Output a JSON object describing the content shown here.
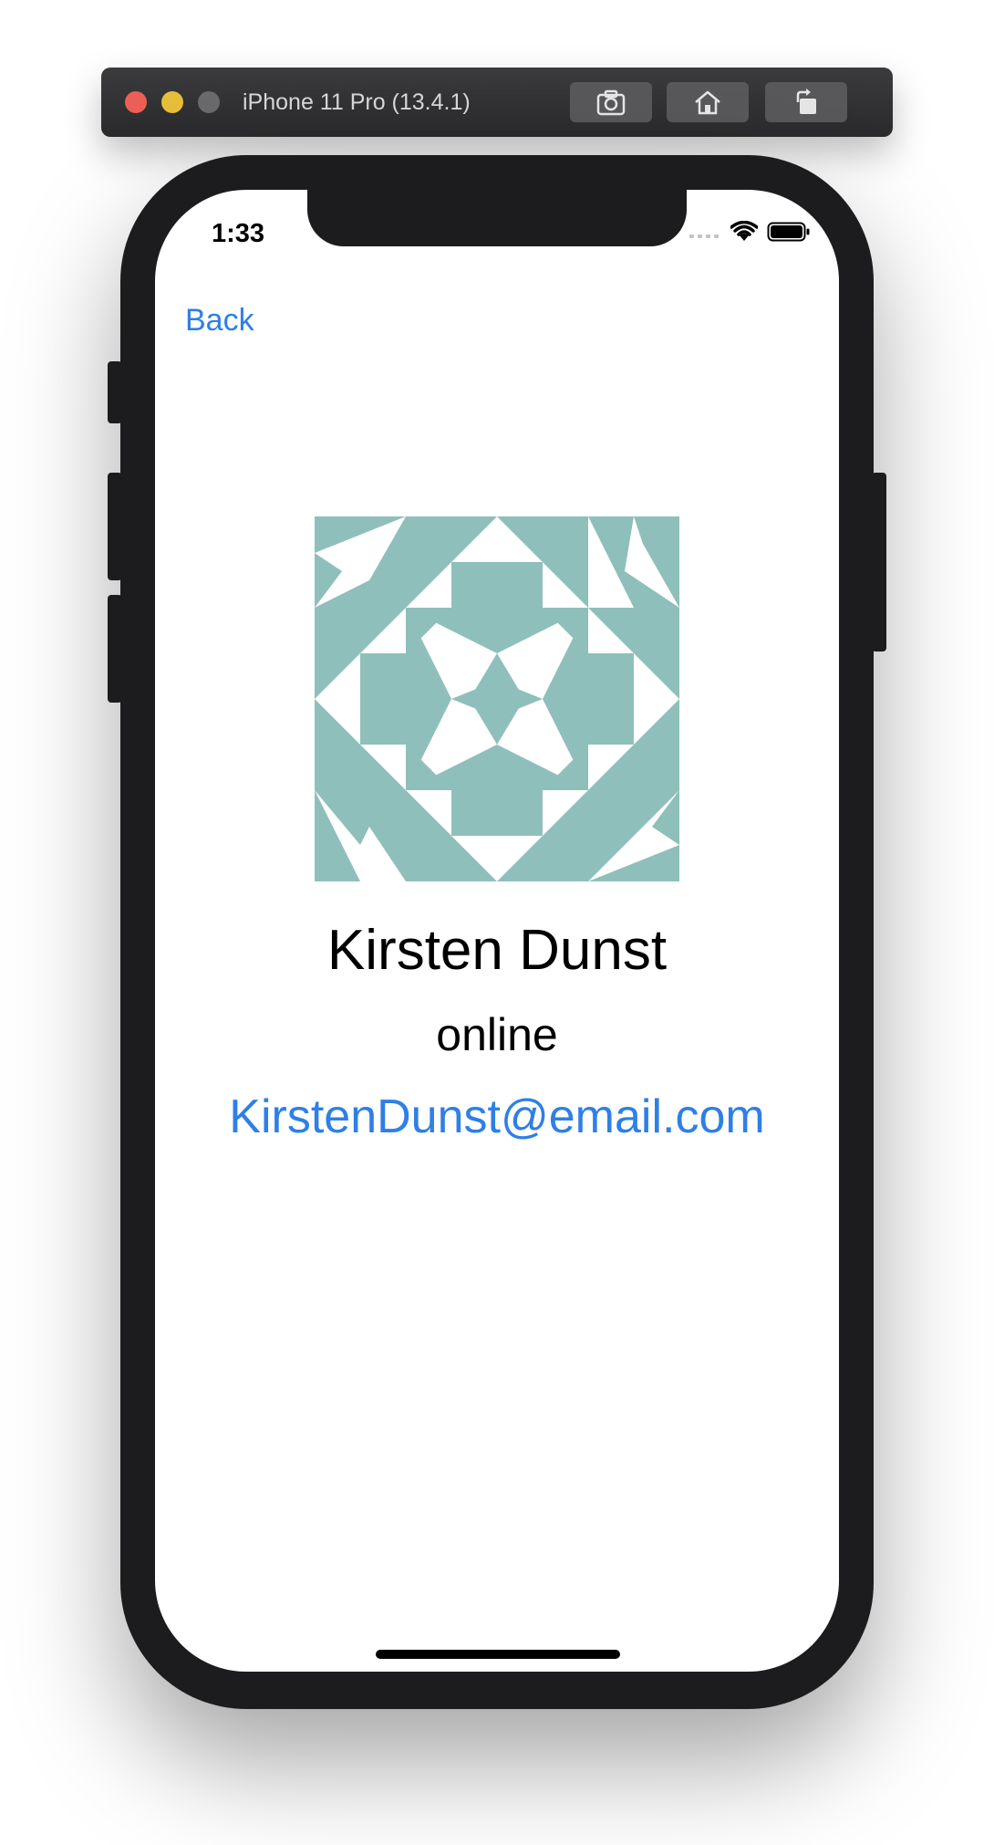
{
  "simulator": {
    "title": "iPhone 11 Pro (13.4.1)",
    "buttons": [
      "screenshot-icon",
      "home-icon",
      "rotate-icon"
    ]
  },
  "status_bar": {
    "time": "1:33",
    "icons": [
      "cellular-signal-icon",
      "wifi-icon",
      "battery-icon"
    ]
  },
  "nav": {
    "back_label": "Back"
  },
  "profile": {
    "avatar": "identicon-avatar",
    "name": "Kirsten Dunst",
    "status": "online",
    "email": "KirstenDunst@email.com"
  },
  "colors": {
    "link": "#2f7fe6",
    "avatar_fill": "#8fbfba",
    "phone_frame": "#1c1c1e"
  }
}
